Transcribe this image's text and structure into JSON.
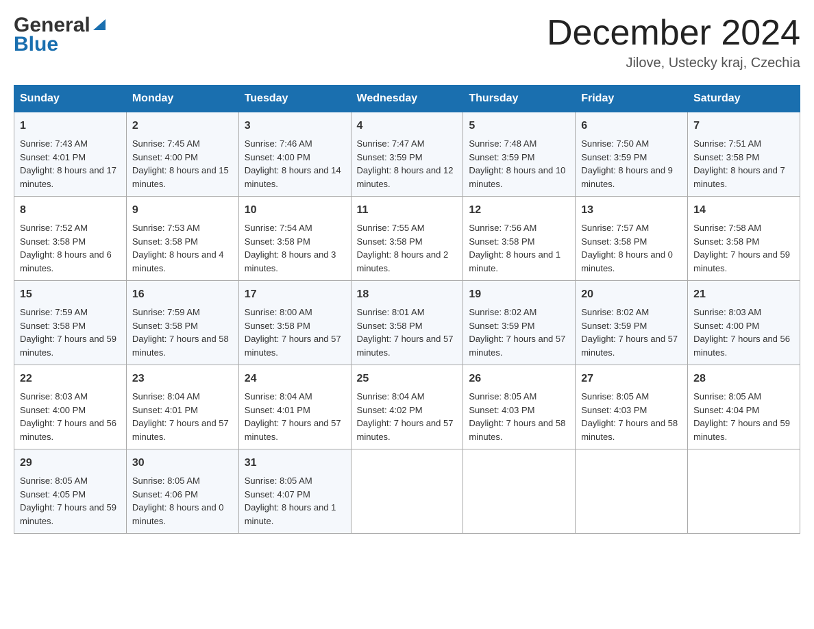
{
  "header": {
    "title": "December 2024",
    "location": "Jilove, Ustecky kraj, Czechia",
    "logo_general": "General",
    "logo_blue": "Blue"
  },
  "days_of_week": [
    "Sunday",
    "Monday",
    "Tuesday",
    "Wednesday",
    "Thursday",
    "Friday",
    "Saturday"
  ],
  "weeks": [
    [
      {
        "day": "1",
        "sunrise": "7:43 AM",
        "sunset": "4:01 PM",
        "daylight": "8 hours and 17 minutes."
      },
      {
        "day": "2",
        "sunrise": "7:45 AM",
        "sunset": "4:00 PM",
        "daylight": "8 hours and 15 minutes."
      },
      {
        "day": "3",
        "sunrise": "7:46 AM",
        "sunset": "4:00 PM",
        "daylight": "8 hours and 14 minutes."
      },
      {
        "day": "4",
        "sunrise": "7:47 AM",
        "sunset": "3:59 PM",
        "daylight": "8 hours and 12 minutes."
      },
      {
        "day": "5",
        "sunrise": "7:48 AM",
        "sunset": "3:59 PM",
        "daylight": "8 hours and 10 minutes."
      },
      {
        "day": "6",
        "sunrise": "7:50 AM",
        "sunset": "3:59 PM",
        "daylight": "8 hours and 9 minutes."
      },
      {
        "day": "7",
        "sunrise": "7:51 AM",
        "sunset": "3:58 PM",
        "daylight": "8 hours and 7 minutes."
      }
    ],
    [
      {
        "day": "8",
        "sunrise": "7:52 AM",
        "sunset": "3:58 PM",
        "daylight": "8 hours and 6 minutes."
      },
      {
        "day": "9",
        "sunrise": "7:53 AM",
        "sunset": "3:58 PM",
        "daylight": "8 hours and 4 minutes."
      },
      {
        "day": "10",
        "sunrise": "7:54 AM",
        "sunset": "3:58 PM",
        "daylight": "8 hours and 3 minutes."
      },
      {
        "day": "11",
        "sunrise": "7:55 AM",
        "sunset": "3:58 PM",
        "daylight": "8 hours and 2 minutes."
      },
      {
        "day": "12",
        "sunrise": "7:56 AM",
        "sunset": "3:58 PM",
        "daylight": "8 hours and 1 minute."
      },
      {
        "day": "13",
        "sunrise": "7:57 AM",
        "sunset": "3:58 PM",
        "daylight": "8 hours and 0 minutes."
      },
      {
        "day": "14",
        "sunrise": "7:58 AM",
        "sunset": "3:58 PM",
        "daylight": "7 hours and 59 minutes."
      }
    ],
    [
      {
        "day": "15",
        "sunrise": "7:59 AM",
        "sunset": "3:58 PM",
        "daylight": "7 hours and 59 minutes."
      },
      {
        "day": "16",
        "sunrise": "7:59 AM",
        "sunset": "3:58 PM",
        "daylight": "7 hours and 58 minutes."
      },
      {
        "day": "17",
        "sunrise": "8:00 AM",
        "sunset": "3:58 PM",
        "daylight": "7 hours and 57 minutes."
      },
      {
        "day": "18",
        "sunrise": "8:01 AM",
        "sunset": "3:58 PM",
        "daylight": "7 hours and 57 minutes."
      },
      {
        "day": "19",
        "sunrise": "8:02 AM",
        "sunset": "3:59 PM",
        "daylight": "7 hours and 57 minutes."
      },
      {
        "day": "20",
        "sunrise": "8:02 AM",
        "sunset": "3:59 PM",
        "daylight": "7 hours and 57 minutes."
      },
      {
        "day": "21",
        "sunrise": "8:03 AM",
        "sunset": "4:00 PM",
        "daylight": "7 hours and 56 minutes."
      }
    ],
    [
      {
        "day": "22",
        "sunrise": "8:03 AM",
        "sunset": "4:00 PM",
        "daylight": "7 hours and 56 minutes."
      },
      {
        "day": "23",
        "sunrise": "8:04 AM",
        "sunset": "4:01 PM",
        "daylight": "7 hours and 57 minutes."
      },
      {
        "day": "24",
        "sunrise": "8:04 AM",
        "sunset": "4:01 PM",
        "daylight": "7 hours and 57 minutes."
      },
      {
        "day": "25",
        "sunrise": "8:04 AM",
        "sunset": "4:02 PM",
        "daylight": "7 hours and 57 minutes."
      },
      {
        "day": "26",
        "sunrise": "8:05 AM",
        "sunset": "4:03 PM",
        "daylight": "7 hours and 58 minutes."
      },
      {
        "day": "27",
        "sunrise": "8:05 AM",
        "sunset": "4:03 PM",
        "daylight": "7 hours and 58 minutes."
      },
      {
        "day": "28",
        "sunrise": "8:05 AM",
        "sunset": "4:04 PM",
        "daylight": "7 hours and 59 minutes."
      }
    ],
    [
      {
        "day": "29",
        "sunrise": "8:05 AM",
        "sunset": "4:05 PM",
        "daylight": "7 hours and 59 minutes."
      },
      {
        "day": "30",
        "sunrise": "8:05 AM",
        "sunset": "4:06 PM",
        "daylight": "8 hours and 0 minutes."
      },
      {
        "day": "31",
        "sunrise": "8:05 AM",
        "sunset": "4:07 PM",
        "daylight": "8 hours and 1 minute."
      },
      null,
      null,
      null,
      null
    ]
  ],
  "labels": {
    "sunrise": "Sunrise:",
    "sunset": "Sunset:",
    "daylight": "Daylight:"
  }
}
